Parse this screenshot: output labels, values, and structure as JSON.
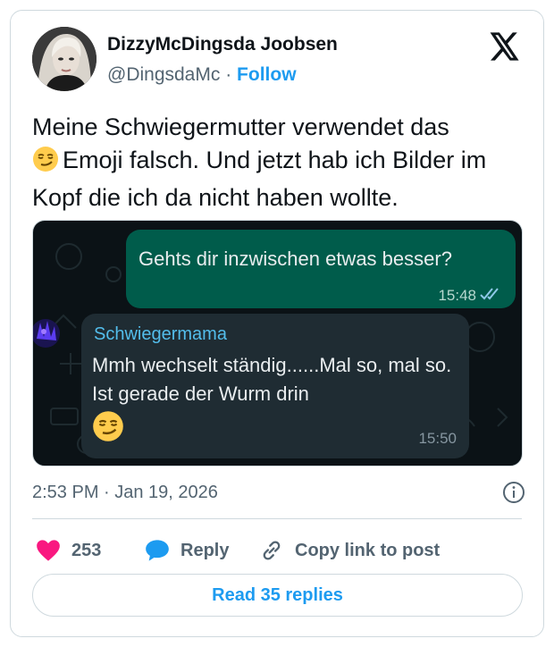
{
  "author": {
    "display_name": "DizzyMcDingsda Joobsen",
    "handle": "@DingsdaMc",
    "separator": "·",
    "follow_label": "Follow"
  },
  "tweet": {
    "text_part1": "Meine Schwiegermutter verwendet das",
    "text_part2": "Emoji falsch. Und jetzt hab ich Bilder im Kopf die ich da nicht haben wollte.",
    "timestamp": "2:53 PM · Jan 19, 2026"
  },
  "chat": {
    "outgoing": {
      "text": "Gehts dir inzwischen etwas besser?",
      "time": "15:48"
    },
    "incoming": {
      "sender": "Schwiegermama",
      "text": "Mmh wechselt ständig......Mal so, mal so. Ist gerade der Wurm drin",
      "time": "15:50"
    }
  },
  "actions": {
    "like_count": "253",
    "reply_label": "Reply",
    "copy_label": "Copy link to post",
    "read_replies_label": "Read 35 replies"
  },
  "icons": {
    "x_logo": "x-logo-icon",
    "emoji": "smirking-face-icon",
    "heart": "heart-icon",
    "reply": "reply-bubble-icon",
    "link": "link-icon",
    "info": "info-icon",
    "read_ticks": "double-check-icon"
  },
  "colors": {
    "accent": "#1d9bf0",
    "heart": "#f91880",
    "outgoing_bubble": "#005c4b",
    "incoming_bubble": "#1f2c33",
    "sender_name": "#53bdeb"
  }
}
